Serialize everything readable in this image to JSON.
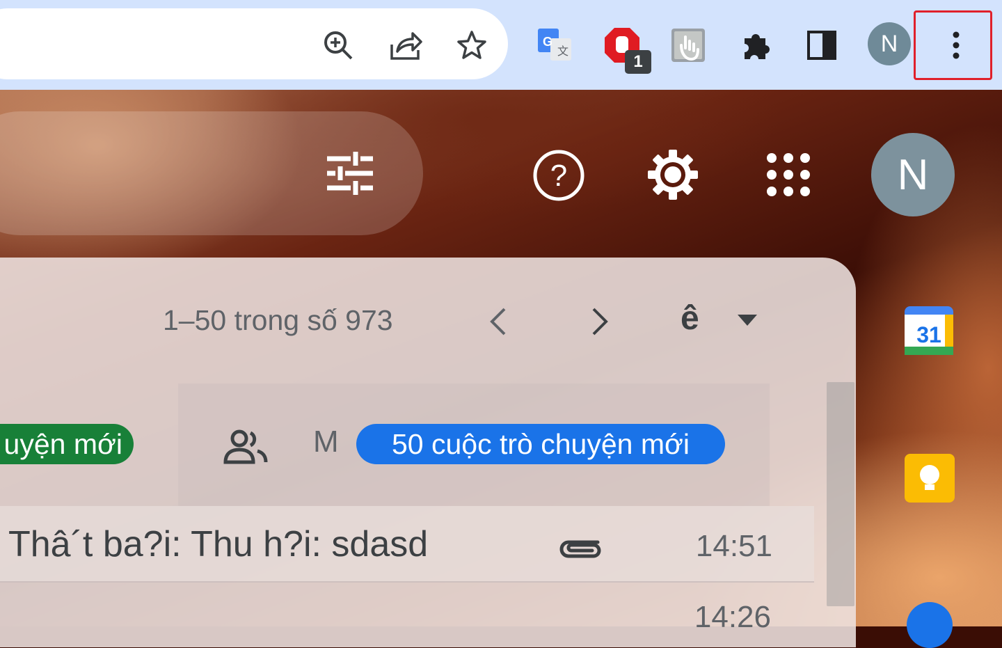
{
  "browser": {
    "profile_initial": "N",
    "adblock_badge": "1",
    "icons": [
      "zoom-icon",
      "share-icon",
      "bookmark-star-icon",
      "google-translate-icon",
      "adblock-icon",
      "extension-hand-icon",
      "extensions-puzzle-icon",
      "side-panel-icon",
      "chrome-menu-icon"
    ],
    "highlight_color": "#e0202a",
    "toolbar_color": "#d3e3fd"
  },
  "gmail": {
    "header": {
      "icons": [
        "search-options-icon",
        "help-icon",
        "settings-gear-icon",
        "apps-grid-icon"
      ],
      "avatar_initial": "N"
    },
    "pagination": {
      "range": "1–50 trong số 973",
      "input_tool_label": "ê"
    },
    "tabs": {
      "primary_chip": "uyện mới",
      "social_letter": "M",
      "social_chip": "50 cuộc trò chuyện mới"
    },
    "emails": [
      {
        "subject": "Thâ´t ba?i: Thu h?i: sdasd",
        "time": "14:51",
        "has_attachment": true
      },
      {
        "subject": "",
        "time": "14:26"
      }
    ],
    "side_apps": {
      "calendar_day": "31",
      "apps": [
        "calendar-icon",
        "keep-icon",
        "tasks-icon"
      ]
    }
  }
}
